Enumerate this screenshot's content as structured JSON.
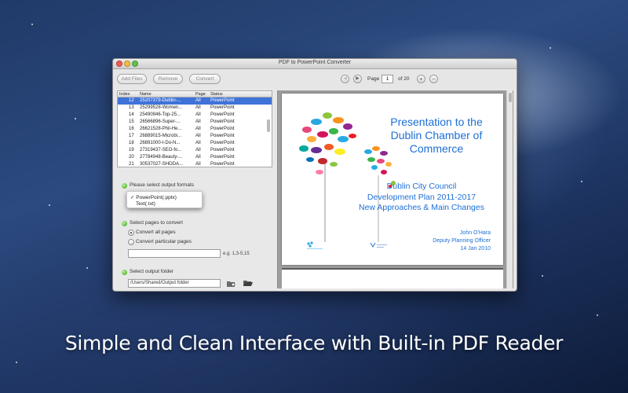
{
  "window": {
    "title": "PDF to PowerPoint Converter"
  },
  "toolbar": {
    "add_files": "Add Files",
    "remove": "Remove",
    "convert": "Convert",
    "page_label": "Page",
    "page_value": "1",
    "page_total": "of 20"
  },
  "file_table": {
    "columns": [
      "Index",
      "Name",
      "Page",
      "Status"
    ],
    "rows": [
      {
        "index": "12",
        "name": "25207379-Dublin-...",
        "page": "All",
        "status": "PowerPoint",
        "selected": true
      },
      {
        "index": "13",
        "name": "25299528-Women...",
        "page": "All",
        "status": "PowerPoint"
      },
      {
        "index": "14",
        "name": "25490946-Top-25...",
        "page": "All",
        "status": "PowerPoint"
      },
      {
        "index": "15",
        "name": "26566896-Super-...",
        "page": "All",
        "status": "PowerPoint"
      },
      {
        "index": "16",
        "name": "26621528-Phil-He...",
        "page": "All",
        "status": "PowerPoint"
      },
      {
        "index": "17",
        "name": "26889015-Microbi...",
        "page": "All",
        "status": "PowerPoint"
      },
      {
        "index": "18",
        "name": "26891000-I-Do-N...",
        "page": "All",
        "status": "PowerPoint"
      },
      {
        "index": "19",
        "name": "27319437-SEO-fo...",
        "page": "All",
        "status": "PowerPoint"
      },
      {
        "index": "20",
        "name": "27784948-Beauty-...",
        "page": "All",
        "status": "PowerPoint"
      },
      {
        "index": "21",
        "name": "30537027-SHODA...",
        "page": "All",
        "status": "PowerPoint"
      }
    ]
  },
  "output_format": {
    "label": "Please select output formats",
    "options": [
      "PowerPoint(.pptx)",
      "Text(.txt)"
    ],
    "checked": "✓"
  },
  "pages": {
    "label": "Select pages to convert",
    "all": "Convert all pages",
    "particular": "Convert particular pages",
    "range_value": "",
    "hint": "e.g. 1,3-5,15"
  },
  "output_folder": {
    "label": "Select output folder",
    "path": "/Users/Shared/Output folder"
  },
  "preview": {
    "title_lines": [
      "Presentation to the",
      "Dublin Chamber of",
      "Commerce"
    ],
    "subtitle_lines": [
      "Dublin City Council",
      "Development Plan 2011-2017",
      "New Approaches & Main Changes"
    ],
    "author_lines": [
      "John O'Hara",
      "Deputy Planning Officer",
      "14 Jan 2010"
    ]
  },
  "caption": "Simple and Clean Interface with Built-in PDF Reader",
  "colors": {
    "selection": "#3f73d8",
    "preview_text": "#1d6fd6"
  }
}
